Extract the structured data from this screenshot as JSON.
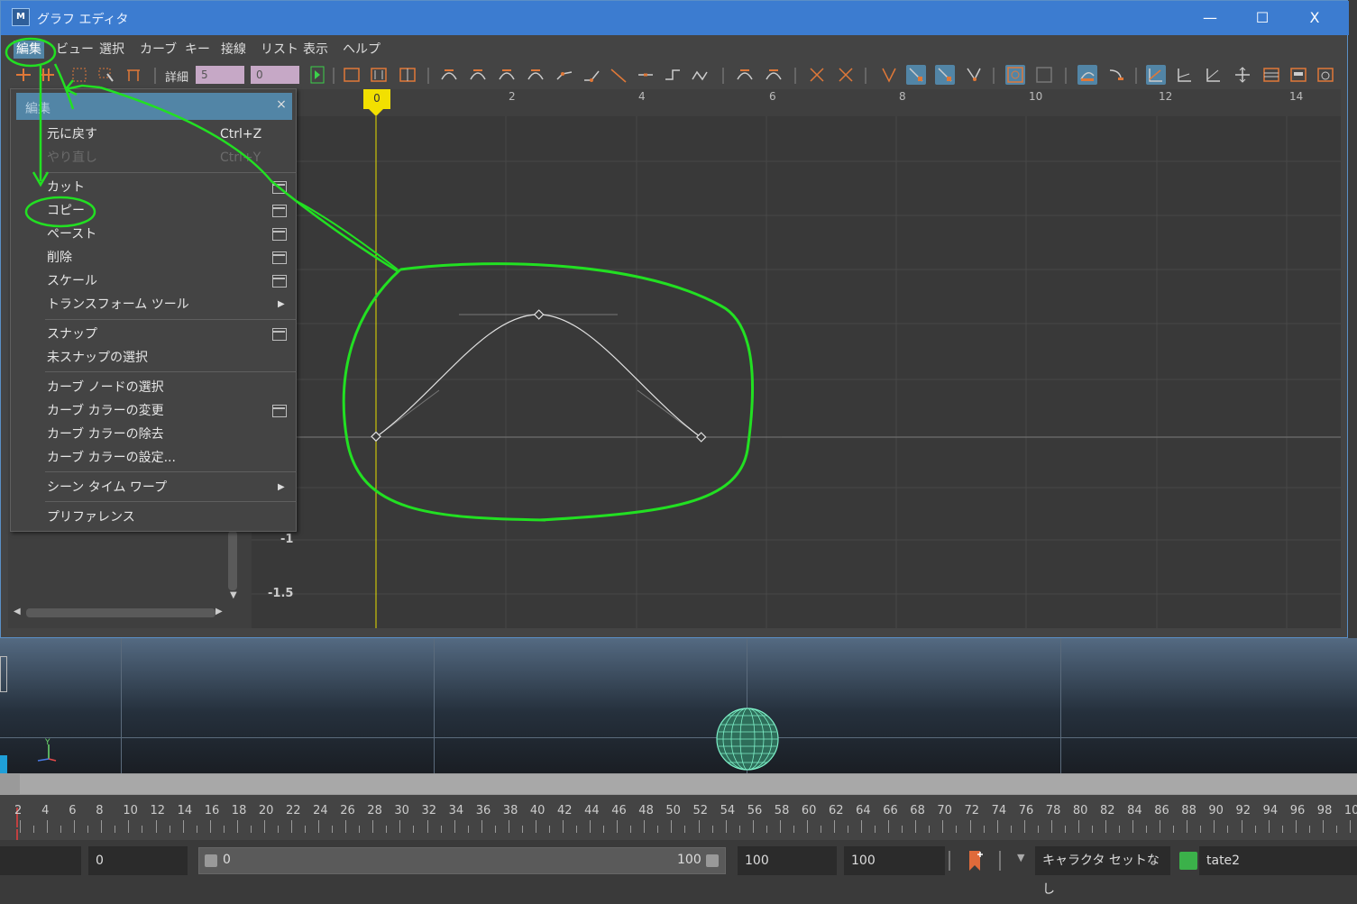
{
  "window": {
    "title": "グラフ エディタ",
    "app_icon_label": "M",
    "controls": {
      "minimize": "—",
      "maximize": "☐",
      "close": "X"
    }
  },
  "menubar": [
    "編集",
    "ビュー",
    "選択",
    "カーブ",
    "キー",
    "接線",
    "リスト",
    "表示",
    "ヘルプ"
  ],
  "toolbar": {
    "detail_label": "詳細",
    "detail_value": "5",
    "second_value": "0"
  },
  "ruler": {
    "current_frame": "0",
    "ticks": [
      "2",
      "4",
      "6",
      "8",
      "10",
      "12",
      "14"
    ]
  },
  "y_axis": {
    "labels": [
      "-1",
      "-1.5"
    ]
  },
  "edit_menu": {
    "title": "編集",
    "close": "×",
    "items": [
      {
        "label": "元に戻す",
        "shortcut": "Ctrl+Z",
        "enabled": true
      },
      {
        "label": "やり直し",
        "shortcut": "Ctrl+Y",
        "enabled": false
      },
      {
        "label": "カット",
        "option_box": true
      },
      {
        "label": "コピー",
        "option_box": true
      },
      {
        "label": "ペースト",
        "option_box": true
      },
      {
        "label": "削除",
        "option_box": true
      },
      {
        "label": "スケール",
        "option_box": true
      },
      {
        "label": "トランスフォーム ツール",
        "submenu": true
      },
      {
        "label": "スナップ",
        "option_box": true
      },
      {
        "label": "未スナップの選択"
      },
      {
        "label": "カーブ ノードの選択"
      },
      {
        "label": "カーブ カラーの変更",
        "option_box": true
      },
      {
        "label": "カーブ カラーの除去"
      },
      {
        "label": "カーブ カラーの設定..."
      },
      {
        "label": "シーン タイム ワープ",
        "submenu": true
      },
      {
        "label": "プリファレンス"
      }
    ]
  },
  "timeline": {
    "ticks": [
      "2",
      "4",
      "6",
      "8",
      "10",
      "12",
      "14",
      "16",
      "18",
      "20",
      "22",
      "24",
      "26",
      "28",
      "30",
      "32",
      "34",
      "36",
      "38",
      "40",
      "42",
      "44",
      "46",
      "48",
      "50",
      "52",
      "54",
      "56",
      "58",
      "60",
      "62",
      "64",
      "66",
      "68",
      "70",
      "72",
      "74",
      "76",
      "78",
      "80",
      "82",
      "84",
      "86",
      "88",
      "90",
      "92",
      "94",
      "96",
      "98",
      "10"
    ]
  },
  "range": {
    "start": "0",
    "slider_start": "0",
    "slider_end": "100",
    "end": "100",
    "anim_end": "100",
    "character_set": "キャラクタ セットなし",
    "layer": "tate2"
  },
  "colors": {
    "titlebar": "#3c7cd0",
    "highlight": "#5285a6",
    "annotation": "#22e022",
    "current_time": "#f2e000"
  }
}
